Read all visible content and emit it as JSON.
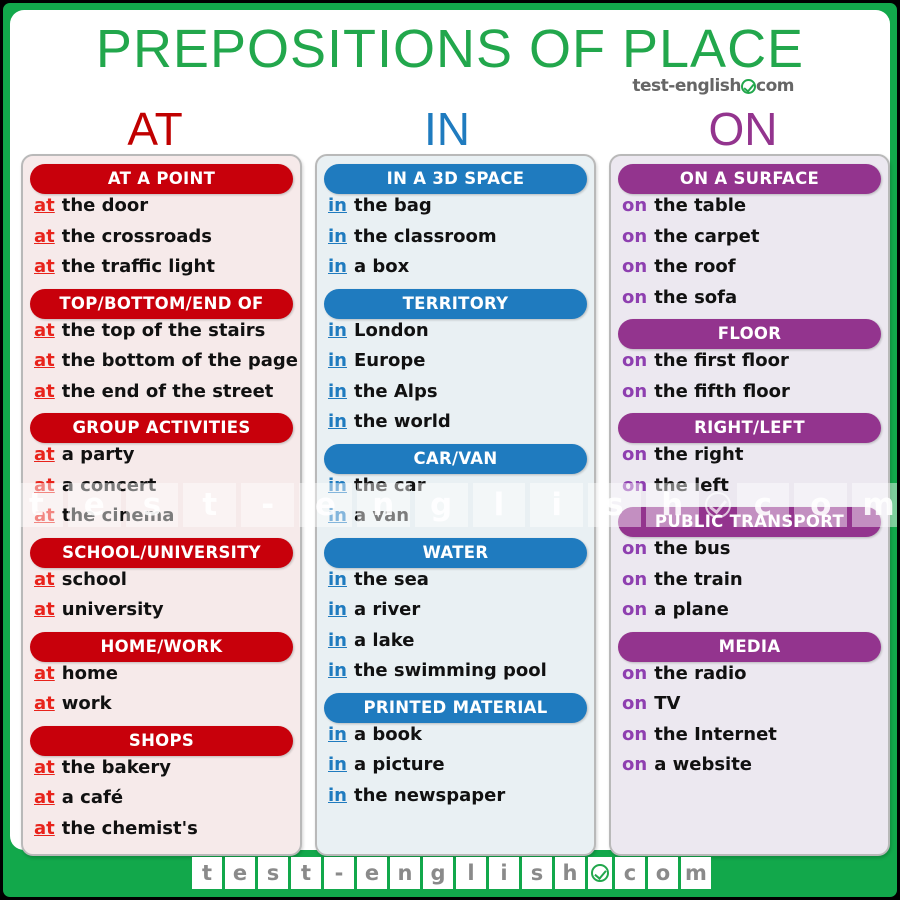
{
  "header": {
    "title": "PREPOSITIONS OF PLACE",
    "brand_left": "test-english",
    "brand_check_icon": "check-circle-icon",
    "brand_right": "com"
  },
  "colors": {
    "frame_green": "#12a84b",
    "title_green": "#22a74c",
    "at_accent": "#c8000b",
    "at_word": "#e8231b",
    "at_card_bg": "#f6eaea",
    "in_accent": "#1f7bbf",
    "in_word": "#1f7bbf",
    "in_card_bg": "#e9f0f3",
    "on_accent": "#93348e",
    "on_word": "#8e3fb0",
    "on_card_bg": "#ece8f0"
  },
  "columns": [
    {
      "letter": "AT",
      "preposition": "at",
      "sections": [
        {
          "header": "AT A POINT",
          "items": [
            "the door",
            "the crossroads",
            "the traffic light"
          ]
        },
        {
          "header": "TOP/BOTTOM/END OF",
          "items": [
            "the top  of the stairs",
            "the bottom of the page",
            "the end of the street"
          ]
        },
        {
          "header": "GROUP ACTIVITIES",
          "items": [
            "a party",
            "a concert",
            "the cinema"
          ]
        },
        {
          "header": "SCHOOL/UNIVERSITY",
          "items": [
            "school",
            "university"
          ]
        },
        {
          "header": "HOME/WORK",
          "items": [
            "home",
            "work"
          ]
        },
        {
          "header": "SHOPS",
          "items": [
            "the bakery",
            "a café",
            "the chemist's"
          ]
        }
      ]
    },
    {
      "letter": "IN",
      "preposition": "in",
      "sections": [
        {
          "header": "IN A 3D SPACE",
          "items": [
            "the bag",
            "the classroom",
            "a box"
          ]
        },
        {
          "header": "TERRITORY",
          "items": [
            "London",
            "Europe",
            "the Alps",
            "the world"
          ]
        },
        {
          "header": "CAR/VAN",
          "items": [
            "the car",
            "a van"
          ]
        },
        {
          "header": "WATER",
          "items": [
            "the sea",
            "a river",
            "a lake",
            "the swimming pool"
          ]
        },
        {
          "header": "PRINTED MATERIAL",
          "items": [
            "a book",
            "a picture",
            "the newspaper"
          ]
        }
      ]
    },
    {
      "letter": "ON",
      "preposition": "on",
      "sections": [
        {
          "header": "ON A SURFACE",
          "items": [
            "the table",
            "the carpet",
            "the roof",
            "the sofa"
          ]
        },
        {
          "header": "FLOOR",
          "items": [
            "the first floor",
            "the fifth floor"
          ]
        },
        {
          "header": "RIGHT/LEFT",
          "items": [
            "the right",
            "the left"
          ]
        },
        {
          "header": "PUBLIC TRANSPORT",
          "items": [
            "the bus",
            "the train",
            "a plane"
          ]
        },
        {
          "header": "MEDIA",
          "items": [
            "the radio",
            "TV",
            "the Internet",
            "a website"
          ]
        }
      ]
    }
  ],
  "watermark": {
    "cells": [
      "t",
      "e",
      "s",
      "t",
      "-",
      "e",
      "n",
      "g",
      "l",
      "i",
      "s",
      "h"
    ],
    "check_icon": "check-circle-icon",
    "cells_after": [
      "c",
      "o",
      "m"
    ]
  },
  "footer": {
    "cells": [
      "t",
      "e",
      "s",
      "t",
      "-",
      "e",
      "n",
      "g",
      "l",
      "i",
      "s",
      "h"
    ],
    "check_icon": "check-circle-icon",
    "cells_after": [
      "c",
      "o",
      "m"
    ]
  }
}
